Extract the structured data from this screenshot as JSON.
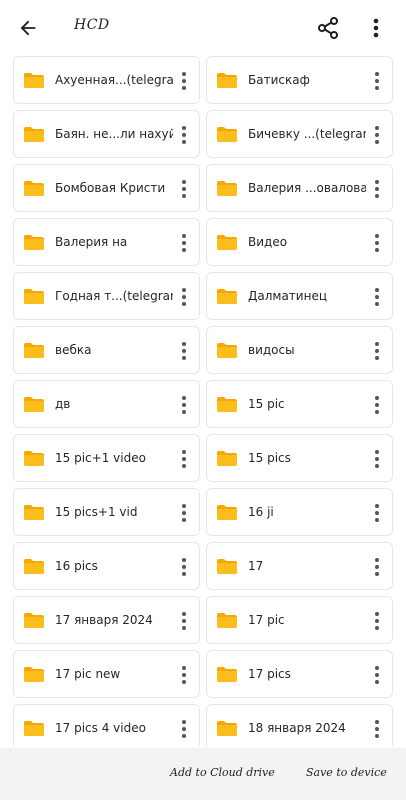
{
  "header": {
    "title": "HCD"
  },
  "folders": [
    [
      "Ахуенная...(telegram)",
      "Батискаф"
    ],
    [
      "Баян. не...ли нахуй",
      "Бичевку ...(telegram)"
    ],
    [
      "Бомбовая Кристи",
      "Валерия ...овалова"
    ],
    [
      "Валерия на",
      "Видео"
    ],
    [
      "Годная т...(telegram)",
      "Далматинец"
    ],
    [
      "вебка",
      "видосы"
    ],
    [
      "дв",
      "15 pic"
    ],
    [
      "15 pic+1 video",
      "15 pics"
    ],
    [
      "15 pics+1 vid",
      "16 ji"
    ],
    [
      "16 pics",
      "17"
    ],
    [
      "17 января 2024",
      "17 pic"
    ],
    [
      "17 pic new",
      "17 pics"
    ],
    [
      "17 pics 4 video",
      "18 января 2024"
    ]
  ],
  "bottom": {
    "cloud_label": "Add to Cloud drive",
    "device_label": "Save to device"
  },
  "colors": {
    "folder": "#fbbd1c",
    "folder_tab": "#f5a800"
  }
}
